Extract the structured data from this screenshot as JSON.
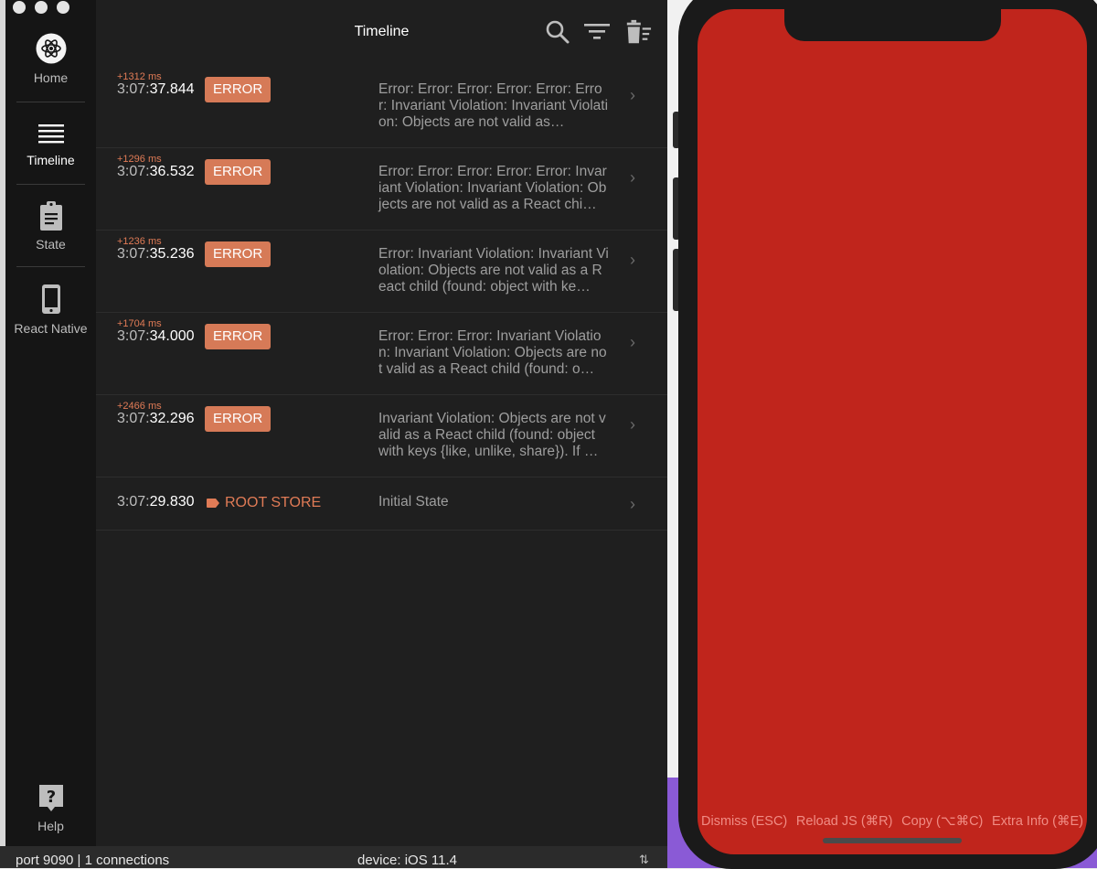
{
  "window": {
    "title": "Timeline"
  },
  "sidebar": {
    "items": [
      {
        "label": "Home",
        "icon": "atom-icon",
        "active": false
      },
      {
        "label": "Timeline",
        "icon": "list-icon",
        "active": true
      },
      {
        "label": "State",
        "icon": "clipboard-icon",
        "active": false
      },
      {
        "label": "React Native",
        "icon": "phone-icon",
        "active": false
      }
    ],
    "help_label": "Help"
  },
  "header": {
    "title": "Timeline",
    "icons": [
      "search-icon",
      "filter-icon",
      "trash-icon"
    ]
  },
  "timeline": {
    "rows": [
      {
        "delta": "+1312 ms",
        "time_prefix": "3:07:",
        "time_main": "37.844",
        "badge": "ERROR",
        "message": "Error: Error: Error: Error: Error: Error: Invariant Violation: Invariant Violation: Objects are not valid as…"
      },
      {
        "delta": "+1296 ms",
        "time_prefix": "3:07:",
        "time_main": "36.532",
        "badge": "ERROR",
        "message": "Error: Error: Error: Error: Error: Invariant Violation: Invariant Violation: Objects are not valid as a React chi…"
      },
      {
        "delta": "+1236 ms",
        "time_prefix": "3:07:",
        "time_main": "35.236",
        "badge": "ERROR",
        "message": "Error: Invariant Violation: Invariant Violation: Objects are not valid as a React child (found: object with ke…"
      },
      {
        "delta": "+1704 ms",
        "time_prefix": "3:07:",
        "time_main": "34.000",
        "badge": "ERROR",
        "message": "Error: Error: Error: Invariant Violation: Invariant Violation: Objects are not valid as a React child (found: o…"
      },
      {
        "delta": "+2466 ms",
        "time_prefix": "3:07:",
        "time_main": "32.296",
        "badge": "ERROR",
        "message": "Invariant Violation: Objects are not valid as a React child (found: object with keys {like, unlike, share}). If …"
      }
    ],
    "state_row": {
      "time_prefix": "3:07:",
      "time_main": "29.830",
      "label": "ROOT STORE",
      "message": "Initial State"
    }
  },
  "statusbar": {
    "left": "port 9090 | 1 connections",
    "middle": "device: iOS 11.4",
    "right_icon": "arrows-updown-icon"
  },
  "simulator": {
    "screen_color": "#c0251c",
    "actions": [
      "Dismiss (ESC)",
      "Reload JS (⌘R)",
      "Copy (⌥⌘C)",
      "Extra Info (⌘E)"
    ]
  },
  "colors": {
    "accent": "#d67a57",
    "background": "#1f1f1f",
    "sidebar": "#151515",
    "redbox": "#c0251c"
  }
}
